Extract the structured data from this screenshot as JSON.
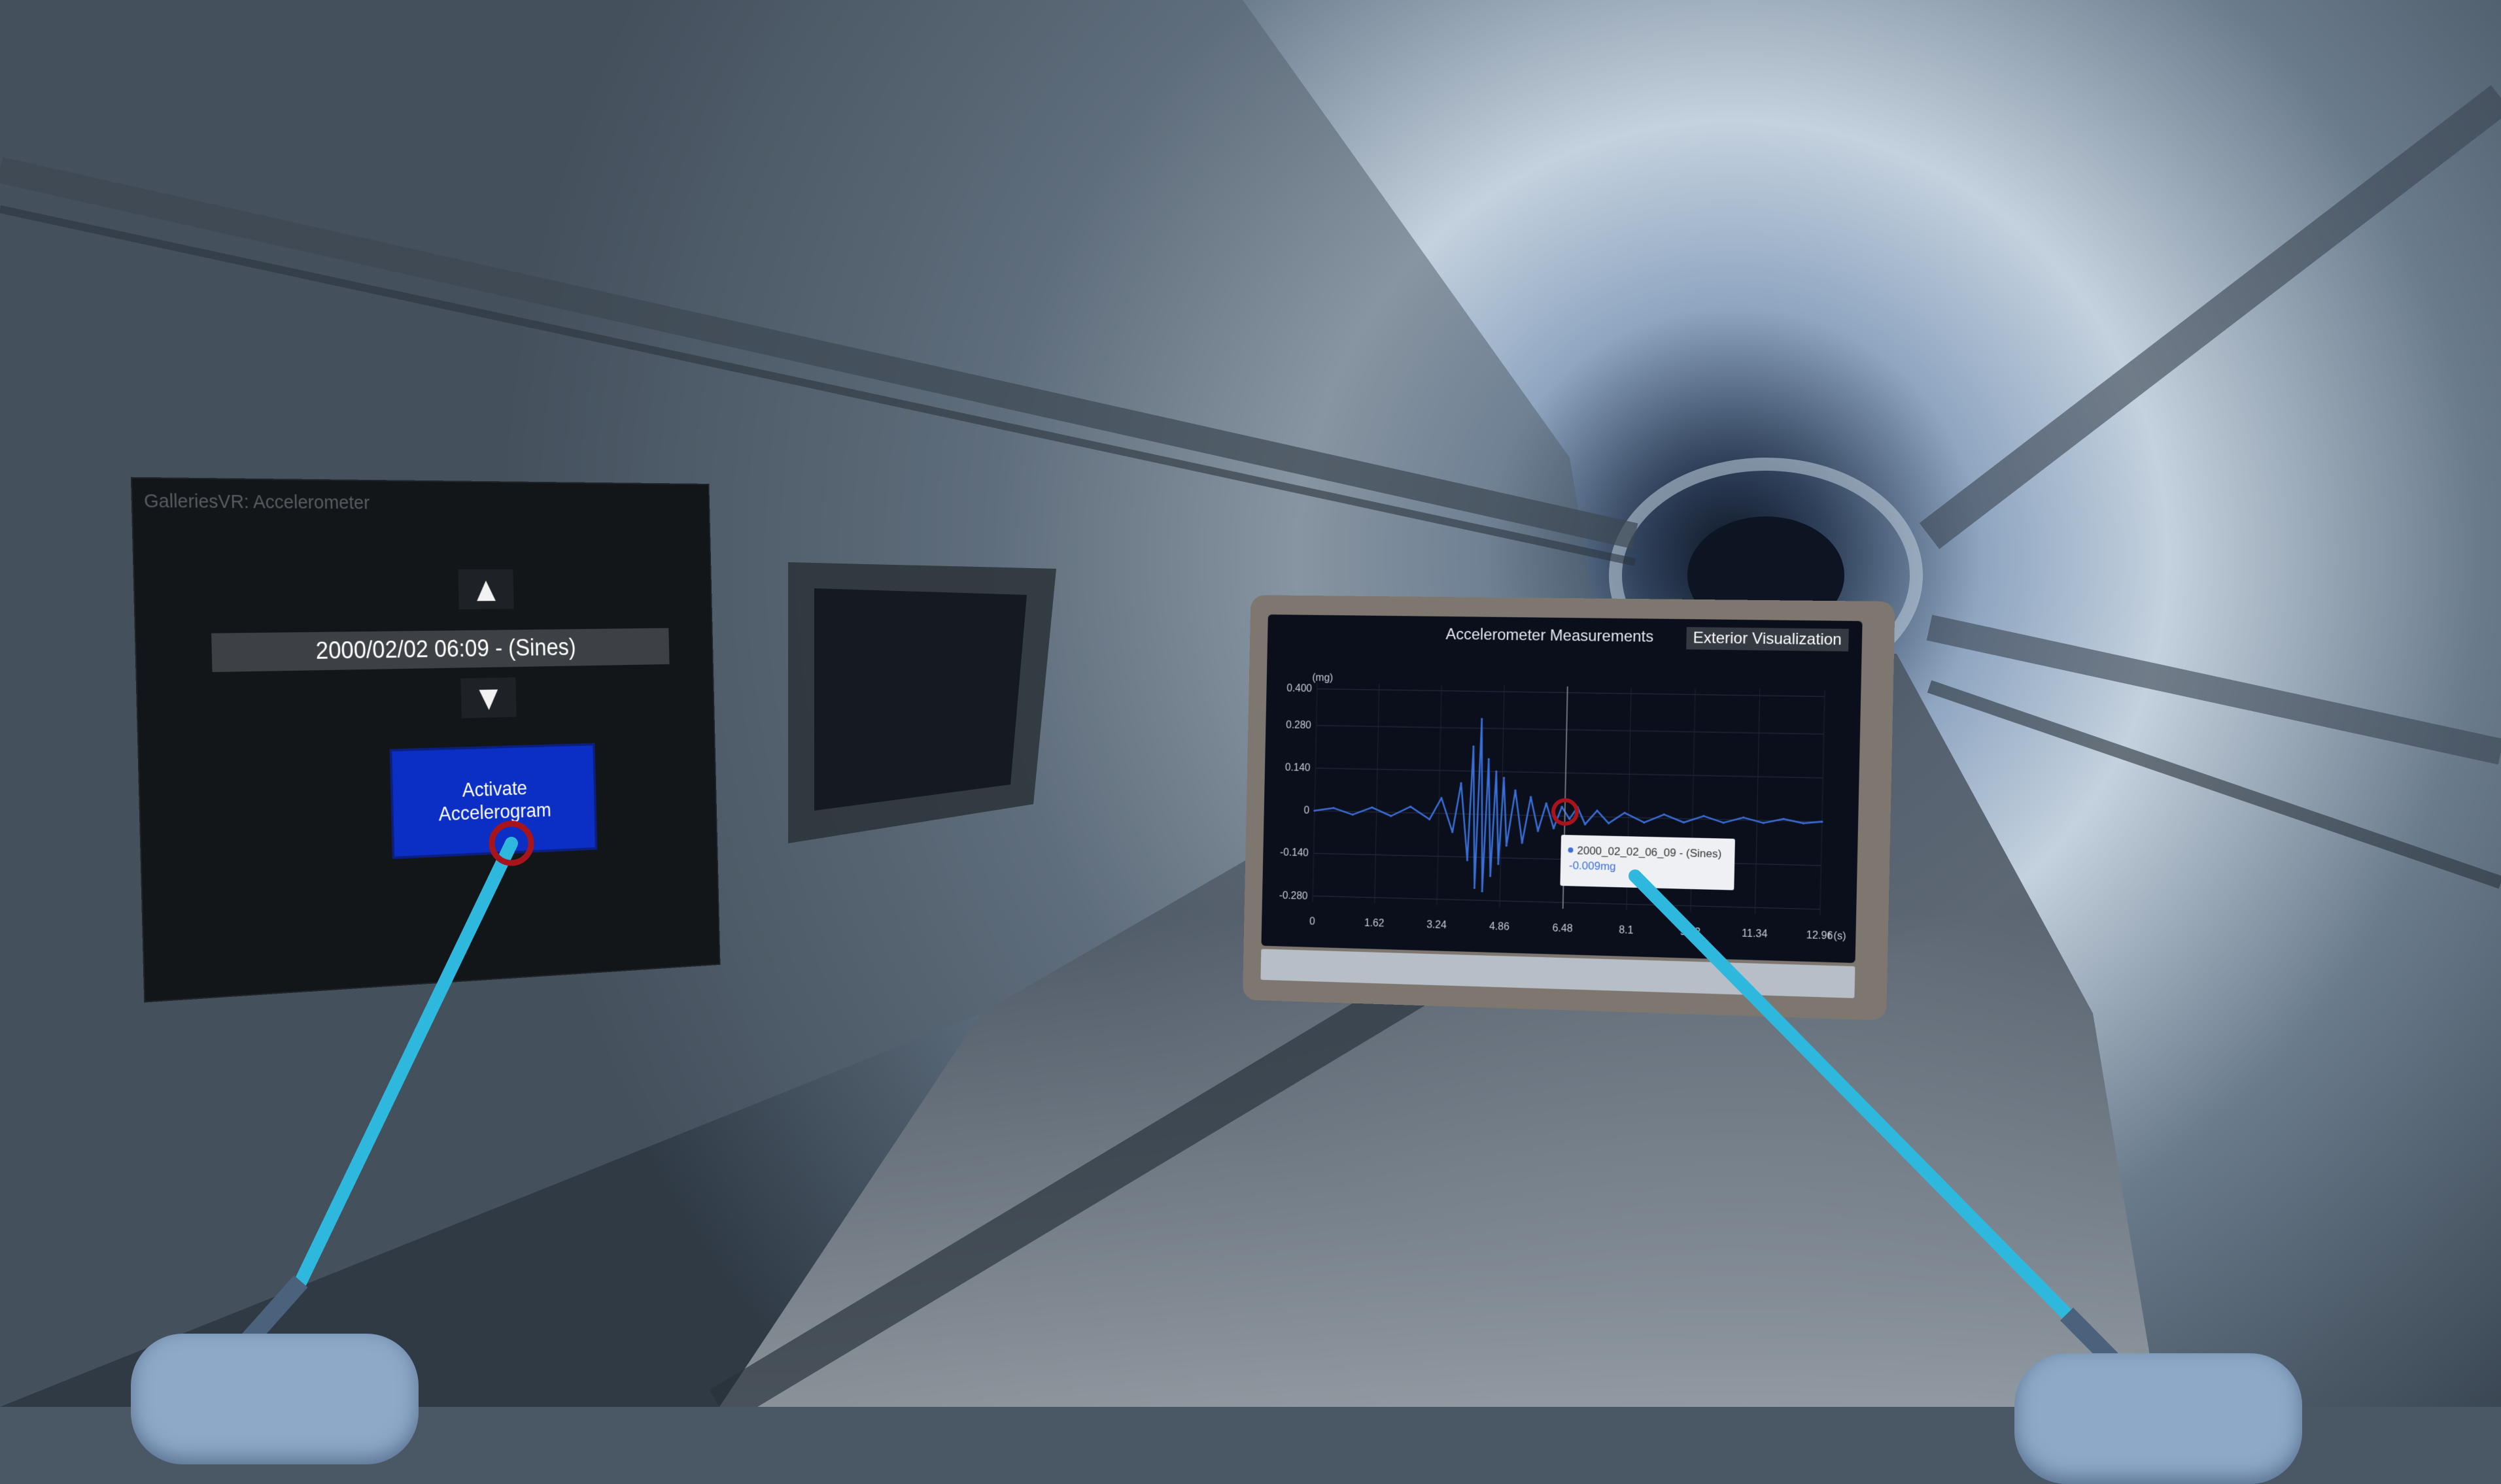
{
  "left_panel": {
    "title": "GalleriesVR: Accelerometer",
    "up_arrow": "▲",
    "down_arrow": "▼",
    "selected_record": "2000/02/02 06:09 - (Sines)",
    "activate_button": "Activate Accelerogram"
  },
  "chart_panel": {
    "exterior_button": "Exterior Visualization",
    "tooltip": {
      "series": "2000_02_02_06_09 - (Sines)",
      "value": "-0.009mg"
    }
  },
  "chart_data": {
    "type": "line",
    "title": "Accelerometer Measurements",
    "ylabel": "(mg)",
    "xlabel": "t (s)",
    "ylim": [
      -0.3,
      0.42
    ],
    "xlim": [
      0,
      12.96
    ],
    "y_ticks": [
      "0.400",
      "0.280",
      "0.140",
      "0",
      "-0.140",
      "-0.280"
    ],
    "y_tick_values": [
      0.4,
      0.28,
      0.14,
      0,
      -0.14,
      -0.28
    ],
    "x_ticks": [
      "0",
      "1.62",
      "3.24",
      "4.86",
      "6.48",
      "8.1",
      "9.72",
      "11.34",
      "12.96"
    ],
    "x_tick_values": [
      0,
      1.62,
      3.24,
      4.86,
      6.48,
      8.1,
      9.72,
      11.34,
      12.96
    ],
    "series": [
      {
        "name": "2000_02_02_06_09 - (Sines)",
        "color": "#3a6fd8",
        "x": [
          0,
          0.5,
          1.0,
          1.5,
          2.0,
          2.5,
          3.0,
          3.3,
          3.6,
          3.8,
          4.0,
          4.1,
          4.2,
          4.3,
          4.4,
          4.5,
          4.6,
          4.7,
          4.8,
          4.9,
          5.0,
          5.2,
          5.4,
          5.6,
          5.8,
          6.0,
          6.2,
          6.4,
          6.6,
          6.8,
          7.0,
          7.3,
          7.6,
          8.0,
          8.5,
          9.0,
          9.5,
          10.0,
          10.5,
          11.0,
          11.5,
          12.0,
          12.5,
          12.96
        ],
        "y": [
          0.0,
          0.01,
          -0.01,
          0.015,
          -0.012,
          0.02,
          -0.02,
          0.05,
          -0.06,
          0.1,
          -0.15,
          0.22,
          -0.24,
          0.31,
          -0.25,
          0.18,
          -0.2,
          0.14,
          -0.16,
          0.12,
          -0.1,
          0.08,
          -0.09,
          0.06,
          -0.05,
          0.04,
          -0.04,
          0.03,
          -0.009,
          0.03,
          -0.025,
          0.02,
          -0.02,
          0.015,
          -0.015,
          0.012,
          -0.012,
          0.01,
          -0.01,
          0.008,
          -0.008,
          0.006,
          -0.006,
          0.0
        ]
      }
    ],
    "crosshair_x": 6.48,
    "grid": true,
    "legend": "none"
  },
  "colors": {
    "laser": "#2fb8de",
    "activate_button": "#0b2fc4",
    "pointer_ring": "#a8141c"
  }
}
